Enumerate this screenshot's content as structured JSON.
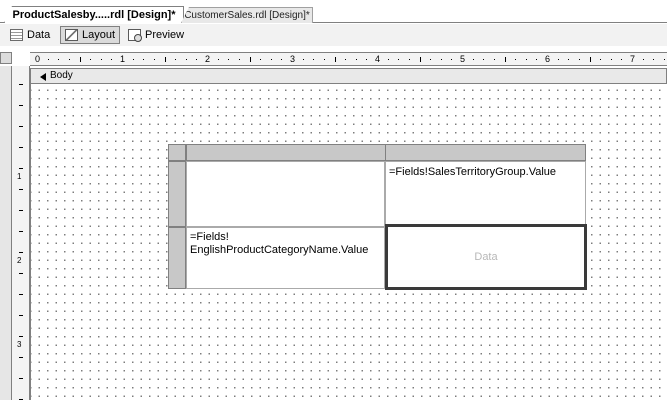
{
  "tabs": [
    {
      "label": "ProductSalesby.....rdl [Design]*",
      "active": true
    },
    {
      "label": "CustomerSales.rdl [Design]*",
      "active": false
    }
  ],
  "views": {
    "data_label": "Data",
    "layout_label": "Layout",
    "preview_label": "Preview",
    "selected": "Layout"
  },
  "ruler": {
    "top_numbers": [
      "0",
      "1",
      "2",
      "3",
      "4",
      "5",
      "6",
      "7"
    ],
    "left_numbers": [
      "1",
      "2",
      "3"
    ]
  },
  "band": {
    "label": "Body"
  },
  "matrix": {
    "column_group_expression": "=Fields!SalesTerritoryGroup.Value",
    "row_group_expression_line1": "=Fields!",
    "row_group_expression_line2": "EnglishProductCategoryName.Value",
    "data_placeholder": "Data"
  },
  "colors": {
    "canvas": "#ffffff",
    "handle_gray": "#c8c8c8",
    "border_dark": "#3a3a3a",
    "placeholder_text": "#b8b8b8"
  }
}
